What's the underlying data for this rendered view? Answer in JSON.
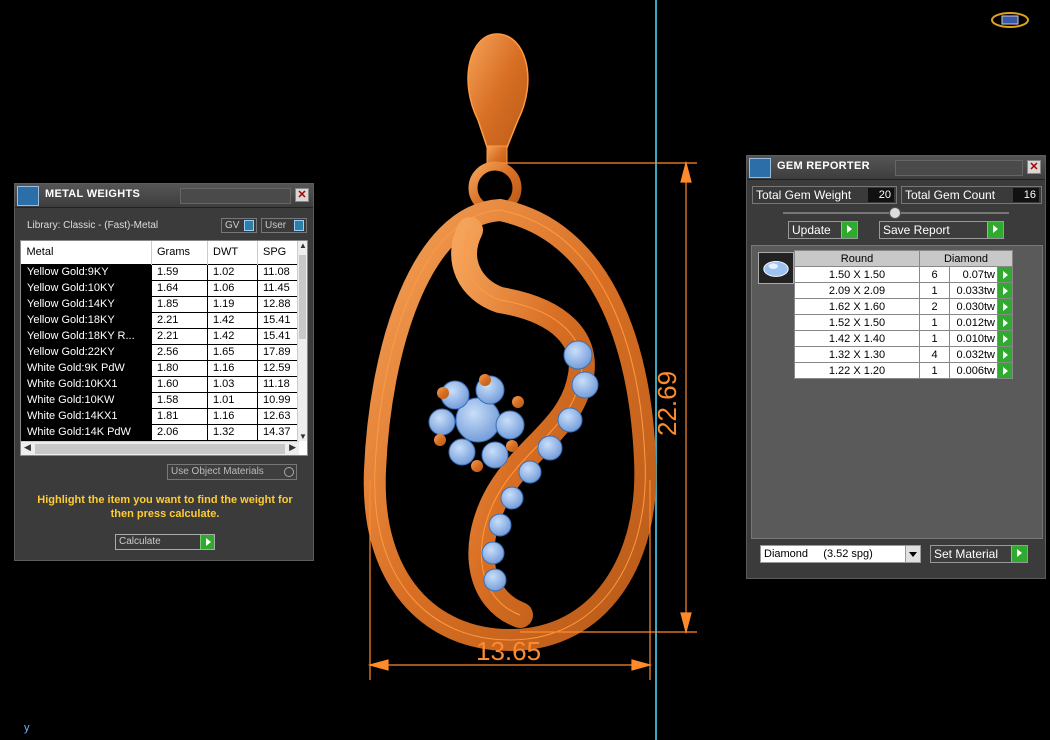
{
  "viewport": {
    "dimension_width": "13.65",
    "dimension_height": "22.69",
    "axis_label": "y"
  },
  "metal_weights": {
    "title": "METAL WEIGHTS",
    "library": "Library: Classic - (Fast)-Metal",
    "toggle_gv": "GV",
    "toggle_user": "User",
    "columns": [
      "Metal",
      "Grams",
      "DWT",
      "SPG"
    ],
    "rows": [
      [
        "Yellow Gold:9KY",
        "1.59",
        "1.02",
        "11.08"
      ],
      [
        "Yellow Gold:10KY",
        "1.64",
        "1.06",
        "11.45"
      ],
      [
        "Yellow Gold:14KY",
        "1.85",
        "1.19",
        "12.88"
      ],
      [
        "Yellow Gold:18KY",
        "2.21",
        "1.42",
        "15.41"
      ],
      [
        "Yellow Gold:18KY R...",
        "2.21",
        "1.42",
        "15.41"
      ],
      [
        "Yellow Gold:22KY",
        "2.56",
        "1.65",
        "17.89"
      ],
      [
        "White Gold:9K PdW",
        "1.80",
        "1.16",
        "12.59"
      ],
      [
        "White Gold:10KX1",
        "1.60",
        "1.03",
        "11.18"
      ],
      [
        "White Gold:10KW",
        "1.58",
        "1.01",
        "10.99"
      ],
      [
        "White Gold:14KX1",
        "1.81",
        "1.16",
        "12.63"
      ],
      [
        "White Gold:14K PdW",
        "2.06",
        "1.32",
        "14.37"
      ]
    ],
    "use_object_materials": "Use Object Materials",
    "hint": "Highlight the item you want to find the weight for then press calculate.",
    "calculate_label": "Calculate"
  },
  "gem_reporter": {
    "title": "GEM REPORTER",
    "total_weight_label": "Total Gem Weight",
    "total_weight_value": "20",
    "total_count_label": "Total Gem Count",
    "total_count_value": "16",
    "update_label": "Update",
    "save_report_label": "Save Report",
    "columns": [
      "Round",
      "Diamond"
    ],
    "rows": [
      [
        "1.50 X 1.50",
        "6",
        "0.07tw"
      ],
      [
        "2.09 X 2.09",
        "1",
        "0.033tw"
      ],
      [
        "1.62 X 1.60",
        "2",
        "0.030tw"
      ],
      [
        "1.52 X 1.50",
        "1",
        "0.012tw"
      ],
      [
        "1.42 X 1.40",
        "1",
        "0.010tw"
      ],
      [
        "1.32 X 1.30",
        "4",
        "0.032tw"
      ],
      [
        "1.22 X 1.20",
        "1",
        "0.006tw"
      ]
    ],
    "material_select": "Diamond     (3.52 spg)",
    "set_material_label": "Set Material"
  },
  "colors": {
    "metal": "#e07a2a",
    "metal_light": "#f2a055",
    "gem": "#8fb8f0",
    "dimension": "#ff8a2b",
    "guide_line": "#3aa8c0",
    "hint_text": "#ffcc33"
  }
}
